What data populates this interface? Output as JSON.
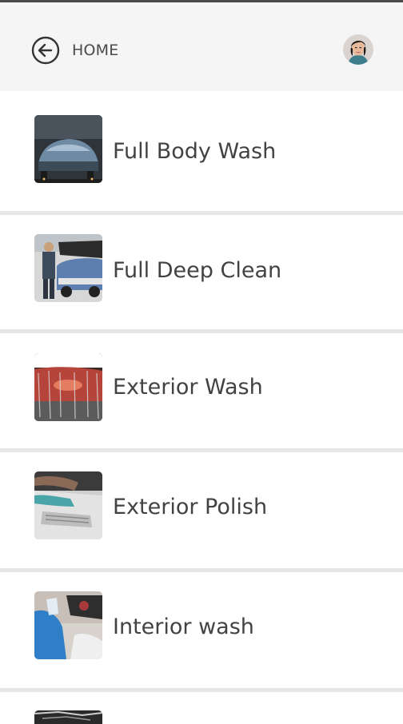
{
  "header": {
    "back_label": "HOME"
  },
  "services": [
    {
      "label": "Full Body Wash"
    },
    {
      "label": "Full Deep Clean"
    },
    {
      "label": "Exterior Wash"
    },
    {
      "label": "Exterior Polish"
    },
    {
      "label": "Interior wash"
    }
  ],
  "icons": {
    "back": "arrow-left-circle-icon",
    "avatar": "user-avatar"
  },
  "colors": {
    "header_bg": "#f5f5f5",
    "text": "#424242",
    "divider": "#e6e6e6",
    "topbar": "#4a4a4a"
  }
}
